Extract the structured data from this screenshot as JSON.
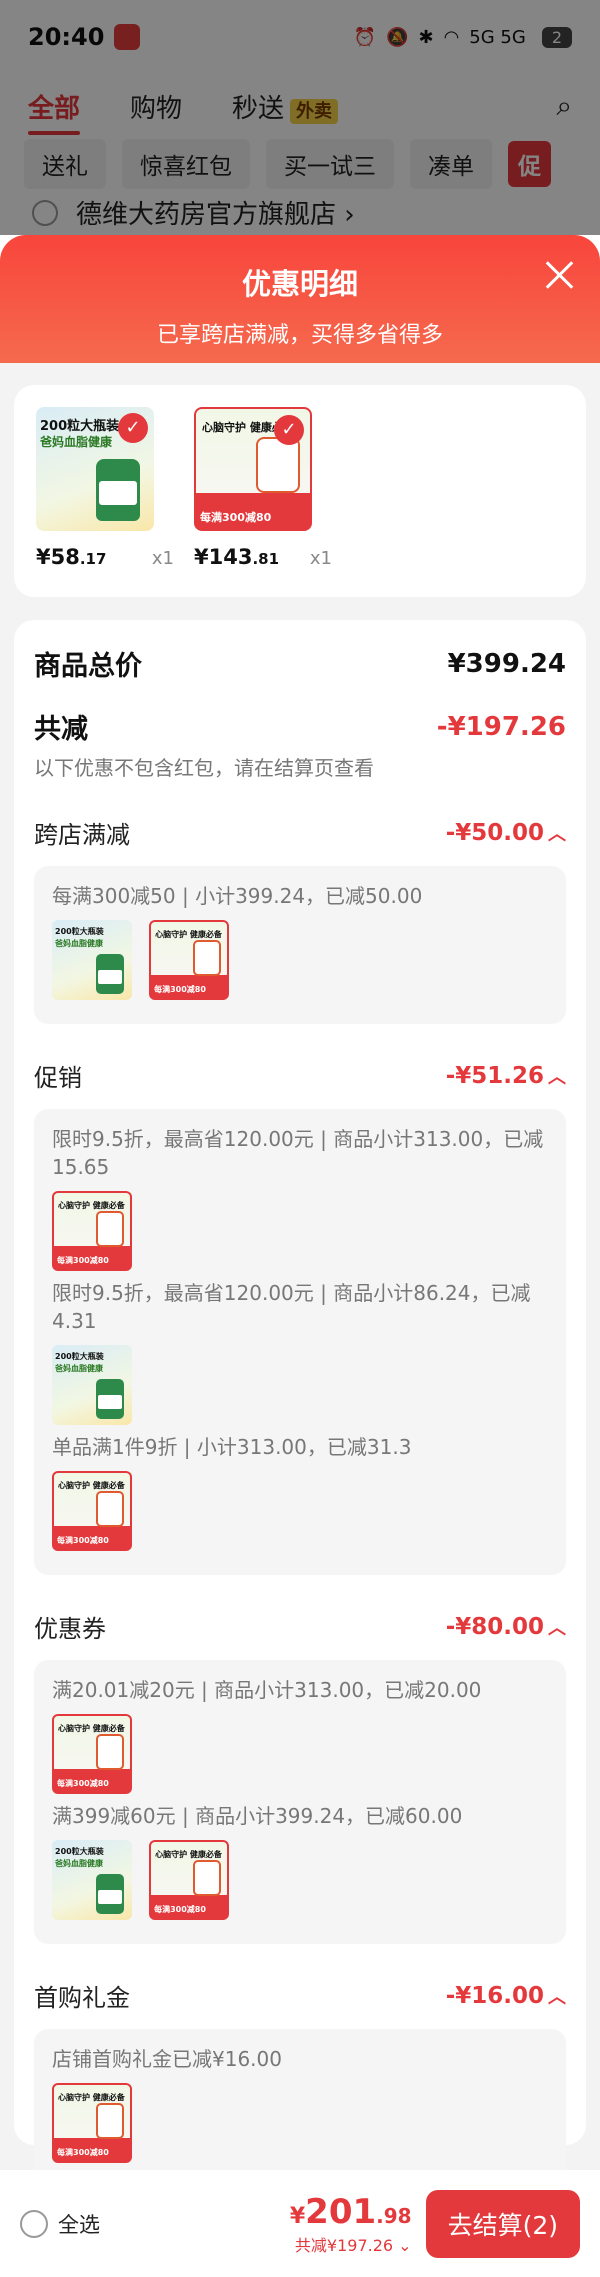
{
  "status": {
    "time": "20:40",
    "network": "5G 5G",
    "battery": "2"
  },
  "tabs": [
    {
      "label": "全部"
    },
    {
      "label": "购物"
    },
    {
      "label": "秒送",
      "tag": "外卖"
    }
  ],
  "chips": [
    "送礼",
    "惊喜红包",
    "买一试三",
    "凑单",
    "促"
  ],
  "shop": {
    "name": "德维大药房官方旗舰店 ›"
  },
  "sheet": {
    "title": "优惠明细",
    "subtitle": "已享跨店满减，买得多省得多"
  },
  "goods": [
    {
      "price_int": "¥58",
      "price_dec": ".17",
      "qty": "x1",
      "text1": "200粒大瓶装",
      "text2": "爸妈血脂健康"
    },
    {
      "price_int": "¥143",
      "price_dec": ".81",
      "qty": "x1",
      "text1": "心脑守护\n健康必备",
      "badge": "每满300减80"
    }
  ],
  "summary": {
    "total_label": "商品总价",
    "total_value": "¥399.24",
    "discount_label": "共减",
    "discount_value": "-¥197.26",
    "note": "以下优惠不包含红包，请在结算页查看"
  },
  "sections": [
    {
      "title": "跨店满减",
      "value": "-¥50.00",
      "lines": [
        "每满300减50 | 小计399.24，已减50.00"
      ]
    },
    {
      "title": "促销",
      "value": "-¥51.26",
      "lines": [
        "限时9.5折，最高省120.00元 | 商品小计313.00，已减15.65",
        "限时9.5折，最高省120.00元 | 商品小计86.24，已减4.31",
        "单品满1件9折 | 小计313.00，已减31.3"
      ]
    },
    {
      "title": "优惠券",
      "value": "-¥80.00",
      "lines": [
        "满20.01减20元 | 商品小计313.00，已减20.00",
        "满399减60元 | 商品小计399.24，已减60.00"
      ]
    },
    {
      "title": "首购礼金",
      "value": "-¥16.00",
      "lines": [
        "店铺首购礼金已减¥16.00"
      ]
    }
  ],
  "bottom": {
    "select_all": "全选",
    "currency": "¥",
    "price_int": "201",
    "price_dec": ".98",
    "discount": "共减¥197.26 ⌄",
    "checkout": "去结算(2)"
  },
  "colors": {
    "accent": "#e4393c"
  }
}
